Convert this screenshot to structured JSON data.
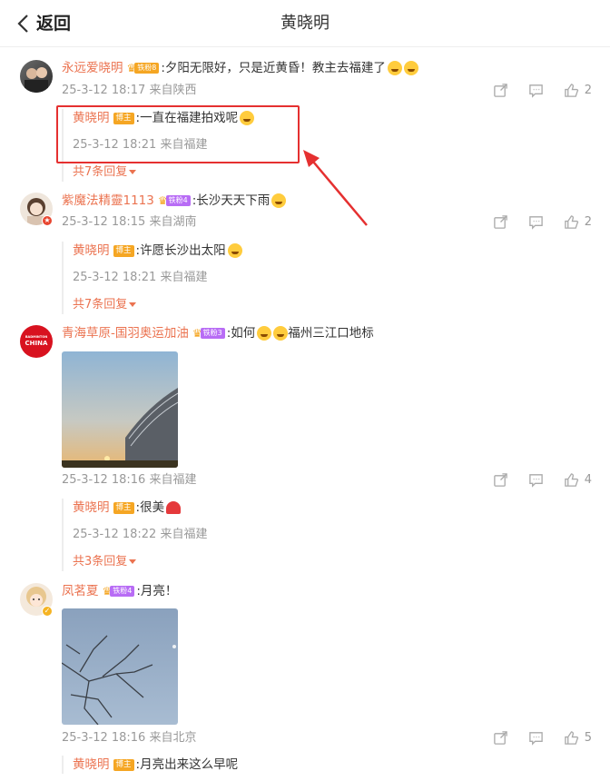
{
  "header": {
    "back_label": "返回",
    "title": "黄晓明"
  },
  "badges": {
    "bozhu": "博主"
  },
  "comments": [
    {
      "user": "永远爱晓明",
      "fan_badge": "铁粉8",
      "text": ":夕阳无限好，只是近黄昏！教主去福建了",
      "meta": "25-3-12 18:17 来自陕西",
      "likes": "2",
      "reply": {
        "user": "黄晓明",
        "text": ":一直在福建拍戏呢",
        "meta": "25-3-12 18:21 来自福建",
        "more": "共7条回复"
      }
    },
    {
      "user": "紫魔法精靈1113",
      "fan_badge": "铁粉4",
      "text": ":长沙天天下雨",
      "meta": "25-3-12 18:15 来自湖南",
      "likes": "2",
      "reply": {
        "user": "黄晓明",
        "text": ":许愿长沙出太阳",
        "meta": "25-3-12 18:21 来自福建",
        "more": "共7条回复"
      }
    },
    {
      "user": "青海草原-国羽奥运加油",
      "fan_badge": "铁粉3",
      "avatar_text": "CHINA",
      "avatar_subtext": "BADMINTON",
      "text": ":如何",
      "text_after": "福州三江口地标",
      "meta": "25-3-12 18:16 来自福建",
      "likes": "4",
      "reply": {
        "user": "黄晓明",
        "text": ":很美",
        "meta": "25-3-12 18:22 来自福建",
        "more": "共3条回复"
      }
    },
    {
      "user": "凤茗夏",
      "fan_badge": "铁粉4",
      "text": ":月亮！",
      "meta": "25-3-12 18:16 来自北京",
      "likes": "5",
      "reply": {
        "user": "黄晓明",
        "text": ":月亮出来这么早呢"
      }
    }
  ],
  "colors": {
    "username": "#eb7350",
    "highlight": "#e53030",
    "meta": "#999999"
  }
}
